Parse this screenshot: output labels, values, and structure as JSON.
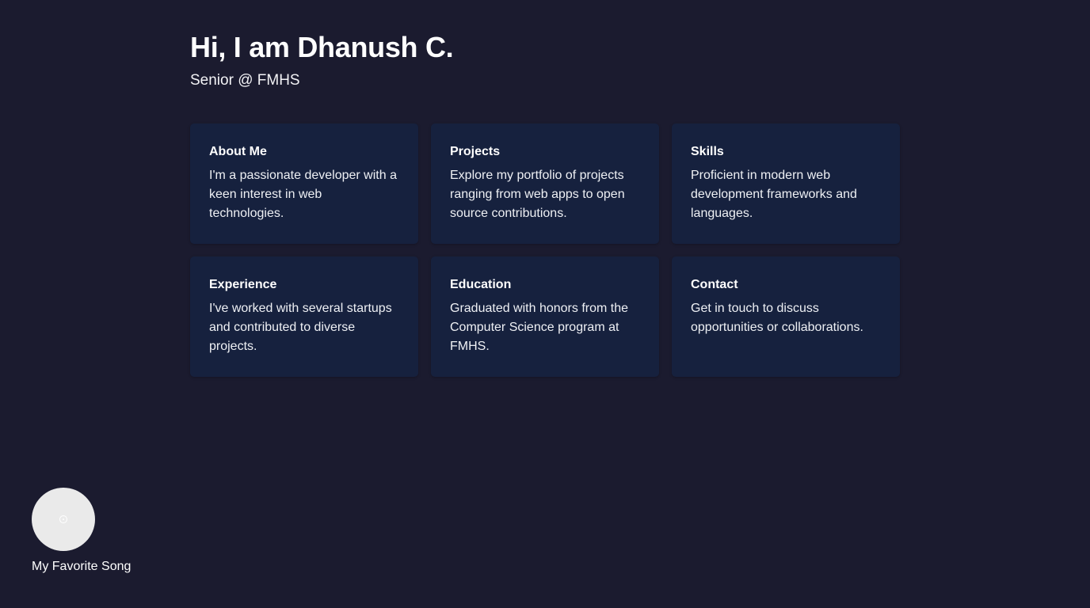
{
  "header": {
    "title": "Hi, I am Dhanush C.",
    "subtitle": "Senior @ FMHS"
  },
  "cards": [
    {
      "title": "About Me",
      "text": "I'm a passionate developer with a keen interest in web technologies."
    },
    {
      "title": "Projects",
      "text": "Explore my portfolio of projects ranging from web apps to open source contributions."
    },
    {
      "title": "Skills",
      "text": "Proficient in modern web development frameworks and languages."
    },
    {
      "title": "Experience",
      "text": "I've worked with several startups and contributed to diverse projects."
    },
    {
      "title": "Education",
      "text": "Graduated with honors from the Computer Science program at FMHS."
    },
    {
      "title": "Contact",
      "text": "Get in touch to discuss opportunities or collaborations."
    }
  ],
  "music_player": {
    "label": "My Favorite Song",
    "icon": "vinyl-disc-icon"
  },
  "colors": {
    "background": "#1b1b2f",
    "card": "#16213e",
    "text": "#ffffff",
    "disc": "#eaeaea"
  }
}
